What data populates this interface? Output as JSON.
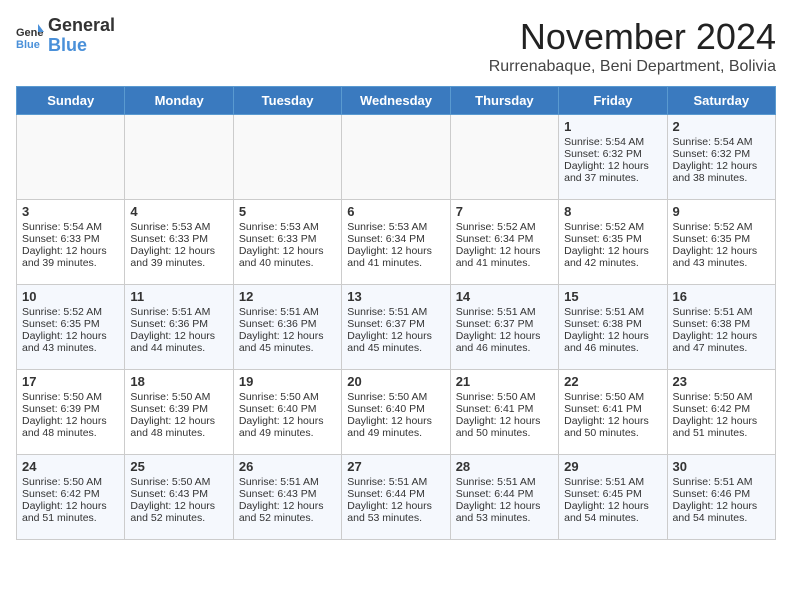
{
  "header": {
    "logo_general": "General",
    "logo_blue": "Blue",
    "month_title": "November 2024",
    "location": "Rurrenabaque, Beni Department, Bolivia"
  },
  "weekdays": [
    "Sunday",
    "Monday",
    "Tuesday",
    "Wednesday",
    "Thursday",
    "Friday",
    "Saturday"
  ],
  "weeks": [
    [
      {
        "day": "",
        "content": ""
      },
      {
        "day": "",
        "content": ""
      },
      {
        "day": "",
        "content": ""
      },
      {
        "day": "",
        "content": ""
      },
      {
        "day": "",
        "content": ""
      },
      {
        "day": "1",
        "content": "Sunrise: 5:54 AM\nSunset: 6:32 PM\nDaylight: 12 hours and 37 minutes."
      },
      {
        "day": "2",
        "content": "Sunrise: 5:54 AM\nSunset: 6:32 PM\nDaylight: 12 hours and 38 minutes."
      }
    ],
    [
      {
        "day": "3",
        "content": "Sunrise: 5:54 AM\nSunset: 6:33 PM\nDaylight: 12 hours and 39 minutes."
      },
      {
        "day": "4",
        "content": "Sunrise: 5:53 AM\nSunset: 6:33 PM\nDaylight: 12 hours and 39 minutes."
      },
      {
        "day": "5",
        "content": "Sunrise: 5:53 AM\nSunset: 6:33 PM\nDaylight: 12 hours and 40 minutes."
      },
      {
        "day": "6",
        "content": "Sunrise: 5:53 AM\nSunset: 6:34 PM\nDaylight: 12 hours and 41 minutes."
      },
      {
        "day": "7",
        "content": "Sunrise: 5:52 AM\nSunset: 6:34 PM\nDaylight: 12 hours and 41 minutes."
      },
      {
        "day": "8",
        "content": "Sunrise: 5:52 AM\nSunset: 6:35 PM\nDaylight: 12 hours and 42 minutes."
      },
      {
        "day": "9",
        "content": "Sunrise: 5:52 AM\nSunset: 6:35 PM\nDaylight: 12 hours and 43 minutes."
      }
    ],
    [
      {
        "day": "10",
        "content": "Sunrise: 5:52 AM\nSunset: 6:35 PM\nDaylight: 12 hours and 43 minutes."
      },
      {
        "day": "11",
        "content": "Sunrise: 5:51 AM\nSunset: 6:36 PM\nDaylight: 12 hours and 44 minutes."
      },
      {
        "day": "12",
        "content": "Sunrise: 5:51 AM\nSunset: 6:36 PM\nDaylight: 12 hours and 45 minutes."
      },
      {
        "day": "13",
        "content": "Sunrise: 5:51 AM\nSunset: 6:37 PM\nDaylight: 12 hours and 45 minutes."
      },
      {
        "day": "14",
        "content": "Sunrise: 5:51 AM\nSunset: 6:37 PM\nDaylight: 12 hours and 46 minutes."
      },
      {
        "day": "15",
        "content": "Sunrise: 5:51 AM\nSunset: 6:38 PM\nDaylight: 12 hours and 46 minutes."
      },
      {
        "day": "16",
        "content": "Sunrise: 5:51 AM\nSunset: 6:38 PM\nDaylight: 12 hours and 47 minutes."
      }
    ],
    [
      {
        "day": "17",
        "content": "Sunrise: 5:50 AM\nSunset: 6:39 PM\nDaylight: 12 hours and 48 minutes."
      },
      {
        "day": "18",
        "content": "Sunrise: 5:50 AM\nSunset: 6:39 PM\nDaylight: 12 hours and 48 minutes."
      },
      {
        "day": "19",
        "content": "Sunrise: 5:50 AM\nSunset: 6:40 PM\nDaylight: 12 hours and 49 minutes."
      },
      {
        "day": "20",
        "content": "Sunrise: 5:50 AM\nSunset: 6:40 PM\nDaylight: 12 hours and 49 minutes."
      },
      {
        "day": "21",
        "content": "Sunrise: 5:50 AM\nSunset: 6:41 PM\nDaylight: 12 hours and 50 minutes."
      },
      {
        "day": "22",
        "content": "Sunrise: 5:50 AM\nSunset: 6:41 PM\nDaylight: 12 hours and 50 minutes."
      },
      {
        "day": "23",
        "content": "Sunrise: 5:50 AM\nSunset: 6:42 PM\nDaylight: 12 hours and 51 minutes."
      }
    ],
    [
      {
        "day": "24",
        "content": "Sunrise: 5:50 AM\nSunset: 6:42 PM\nDaylight: 12 hours and 51 minutes."
      },
      {
        "day": "25",
        "content": "Sunrise: 5:50 AM\nSunset: 6:43 PM\nDaylight: 12 hours and 52 minutes."
      },
      {
        "day": "26",
        "content": "Sunrise: 5:51 AM\nSunset: 6:43 PM\nDaylight: 12 hours and 52 minutes."
      },
      {
        "day": "27",
        "content": "Sunrise: 5:51 AM\nSunset: 6:44 PM\nDaylight: 12 hours and 53 minutes."
      },
      {
        "day": "28",
        "content": "Sunrise: 5:51 AM\nSunset: 6:44 PM\nDaylight: 12 hours and 53 minutes."
      },
      {
        "day": "29",
        "content": "Sunrise: 5:51 AM\nSunset: 6:45 PM\nDaylight: 12 hours and 54 minutes."
      },
      {
        "day": "30",
        "content": "Sunrise: 5:51 AM\nSunset: 6:46 PM\nDaylight: 12 hours and 54 minutes."
      }
    ]
  ]
}
